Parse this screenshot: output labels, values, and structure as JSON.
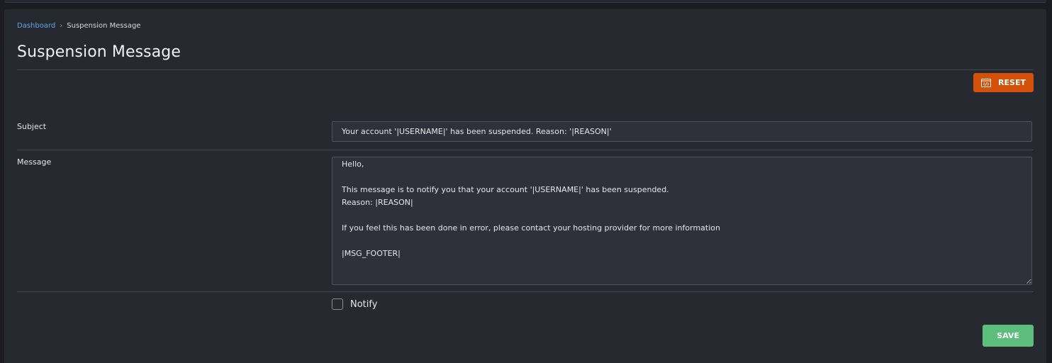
{
  "breadcrumb": {
    "home": "Dashboard",
    "current": "Suspension Message"
  },
  "page": {
    "title": "Suspension Message"
  },
  "toolbar": {
    "reset_label": "RESET",
    "reset_icon": "code-window-icon",
    "accent_color": "#d4510a"
  },
  "form": {
    "subject_label": "Subject",
    "subject_value": "Your account '|USERNAME|' has been suspended. Reason: '|REASON|'",
    "message_label": "Message",
    "message_value": "Hello,\n\nThis message is to notify you that your account '|USERNAME|' has been suspended.\nReason: |REASON|\n\nIf you feel this has been done in error, please contact your hosting provider for more information\n\n|MSG_FOOTER|",
    "notify_label": "Notify",
    "notify_checked": false,
    "save_label": "SAVE",
    "save_color": "#5cbd7c"
  }
}
